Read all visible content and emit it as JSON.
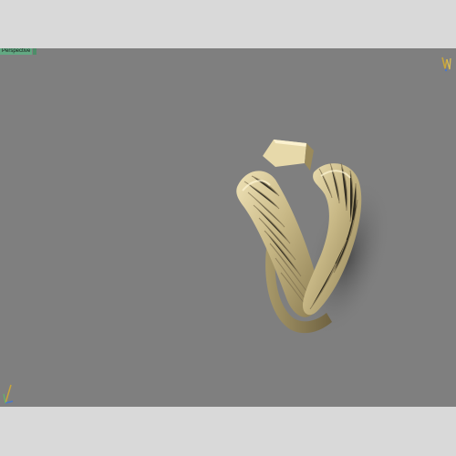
{
  "viewport": {
    "label": "Perspective",
    "background": "#7f7f7f",
    "accent": "#63a983",
    "metal_color": "#c9bb8f"
  },
  "icons": {
    "view_cube": "view-cube-icon",
    "axis_gizmo": "axis-gizmo-icon"
  }
}
